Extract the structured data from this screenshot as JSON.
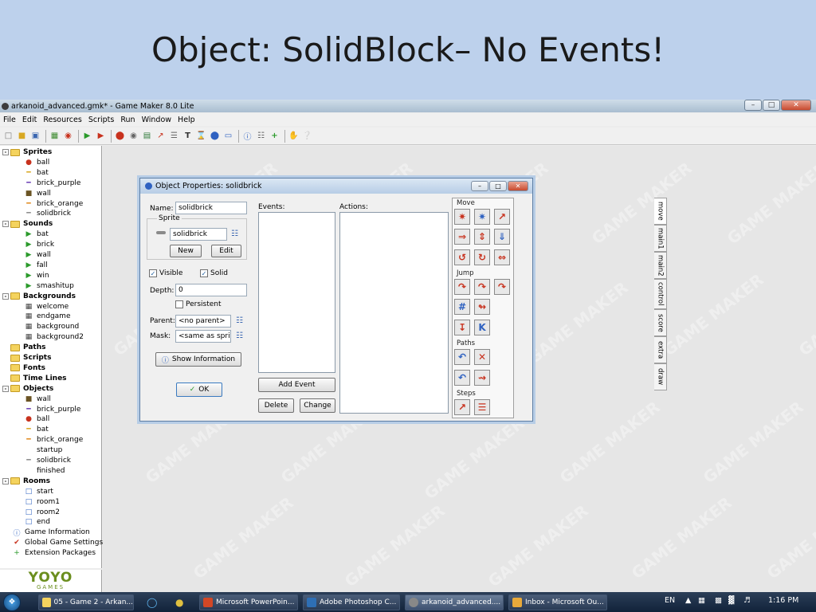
{
  "slide": {
    "title": "Object: SolidBlock– No Events!"
  },
  "window": {
    "title": "arkanoid_advanced.gmk* - Game Maker 8.0 Lite"
  },
  "menu": [
    "File",
    "Edit",
    "Resources",
    "Scripts",
    "Run",
    "Window",
    "Help"
  ],
  "tree": {
    "sprites": {
      "label": "Sprites",
      "items": [
        "ball",
        "bat",
        "brick_purple",
        "wall",
        "brick_orange",
        "solidbrick"
      ]
    },
    "sounds": {
      "label": "Sounds",
      "items": [
        "bat",
        "brick",
        "wall",
        "fall",
        "win",
        "smashitup"
      ]
    },
    "backgrounds": {
      "label": "Backgrounds",
      "items": [
        "welcome",
        "endgame",
        "background",
        "background2"
      ]
    },
    "paths": "Paths",
    "scripts": "Scripts",
    "fonts": "Fonts",
    "timelines": "Time Lines",
    "objects": {
      "label": "Objects",
      "items": [
        "wall",
        "brick_purple",
        "ball",
        "bat",
        "brick_orange",
        "startup",
        "solidbrick",
        "finished"
      ]
    },
    "rooms": {
      "label": "Rooms",
      "items": [
        "start",
        "room1",
        "room2",
        "end"
      ]
    },
    "extras": [
      "Game Information",
      "Global Game Settings",
      "Extension Packages"
    ]
  },
  "logo": {
    "text": "YOYO",
    "sub": "GAMES"
  },
  "watermark": "GAME MAKER",
  "dialog": {
    "title": "Object Properties: solidbrick",
    "name_label": "Name:",
    "name_value": "solidbrick",
    "sprite_group": "Sprite",
    "sprite_value": "solidbrick",
    "new_button": "New",
    "edit_button": "Edit",
    "visible_label": "Visible",
    "solid_label": "Solid",
    "depth_label": "Depth:",
    "depth_value": "0",
    "persistent_label": "Persistent",
    "parent_label": "Parent:",
    "parent_value": "<no parent>",
    "mask_label": "Mask:",
    "mask_value": "<same as sprite>",
    "show_info_button": "Show Information",
    "ok_button": "OK",
    "events_label": "Events:",
    "actions_label": "Actions:",
    "add_event_button": "Add Event",
    "delete_button": "Delete",
    "change_button": "Change",
    "groups": {
      "move": "Move",
      "jump": "Jump",
      "paths": "Paths",
      "steps": "Steps"
    },
    "tabs": [
      "move",
      "main1",
      "main2",
      "control",
      "score",
      "extra",
      "draw"
    ]
  },
  "taskbar": {
    "tasks": [
      "05 - Game 2 - Arkan...",
      "Microsoft PowerPoin...",
      "Adobe Photoshop C...",
      "arkanoid_advanced....",
      "Inbox - Microsoft Ou..."
    ],
    "lang": "EN",
    "time": "1:16 PM"
  },
  "colors": {
    "slide_bg": "#bdd1ec",
    "taskbar": "#1b2c44",
    "tree_folder": "#f4d35e",
    "action_red": "#c8321e",
    "action_blue": "#2f62c1"
  }
}
